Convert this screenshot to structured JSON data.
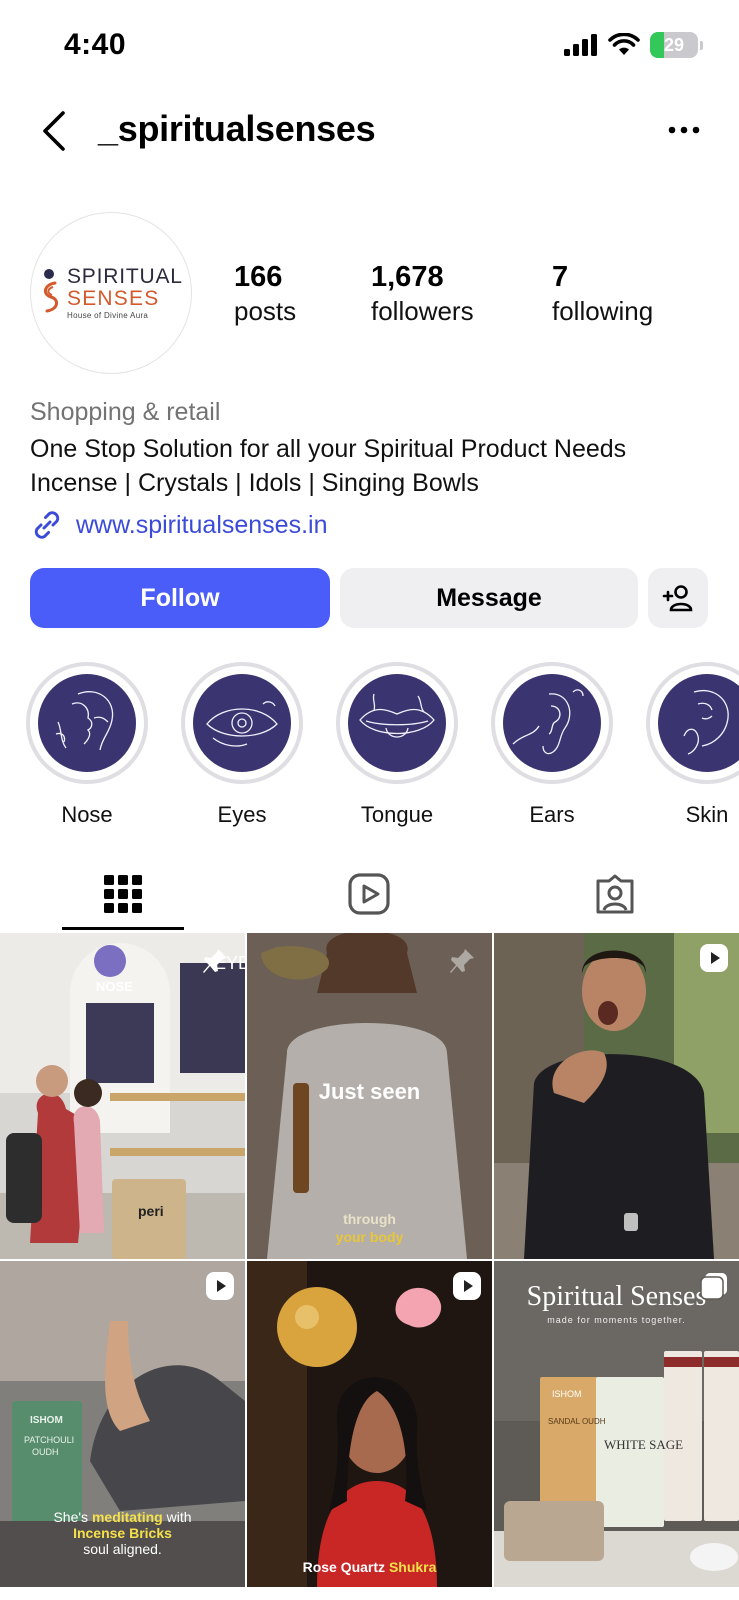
{
  "status": {
    "time": "4:40",
    "battery": "29",
    "battery_level": 0.29,
    "battery_color": "#34c759"
  },
  "header": {
    "username": "_spiritualsenses"
  },
  "profile": {
    "logo": {
      "line1": "SPIRITUAL",
      "line2": "SENSES",
      "tagline": "House of Divine Aura"
    },
    "stats": [
      {
        "value": "166",
        "label": "posts"
      },
      {
        "value": "1,678",
        "label": "followers"
      },
      {
        "value": "7",
        "label": "following"
      }
    ],
    "category": "Shopping & retail",
    "bio_lines": [
      "One Stop Solution for all your Spiritual Product Needs",
      "Incense | Crystals | Idols | Singing Bowls"
    ],
    "link": "www.spiritualsenses.in"
  },
  "actions": {
    "follow": "Follow",
    "message": "Message"
  },
  "highlights": [
    {
      "label": "Nose",
      "icon": "face-line-art-icon"
    },
    {
      "label": "Eyes",
      "icon": "eye-line-art-icon"
    },
    {
      "label": "Tongue",
      "icon": "lips-line-art-icon"
    },
    {
      "label": "Ears",
      "icon": "ear-line-art-icon"
    },
    {
      "label": "Skin",
      "icon": "face-touch-line-art-icon"
    }
  ],
  "tabs": [
    "grid-icon",
    "reels-icon",
    "tagged-icon"
  ],
  "posts": [
    {
      "badge": "pin-icon",
      "texts": [
        "NOSE",
        "EYE",
        "peri"
      ]
    },
    {
      "badge": "pin-icon",
      "overlay": "Just seen",
      "caption_lines": [
        "through",
        "your body"
      ]
    },
    {
      "badge": "reel-icon"
    },
    {
      "badge": "reel-icon",
      "product": [
        "ISHOM",
        "PATCHOULI",
        "OUDH"
      ],
      "caption_parts": [
        "She's ",
        "meditating",
        " with",
        "Incense Bricks",
        "soul aligned."
      ]
    },
    {
      "badge": "reel-icon",
      "caption_parts": [
        "Rose Quartz ",
        "Shukra"
      ]
    },
    {
      "badge": "carousel-icon",
      "title": "Spiritual Senses",
      "subtitle": "made for moments together.",
      "products": [
        "ISHOM",
        "SANDAL OUDH",
        "WHITE SAGE"
      ]
    }
  ],
  "colors": {
    "accent": "#4a5df9",
    "link": "#3b4bd8",
    "highlight_bg": "#3a3470",
    "caption_yellow": "#f5e04a"
  }
}
